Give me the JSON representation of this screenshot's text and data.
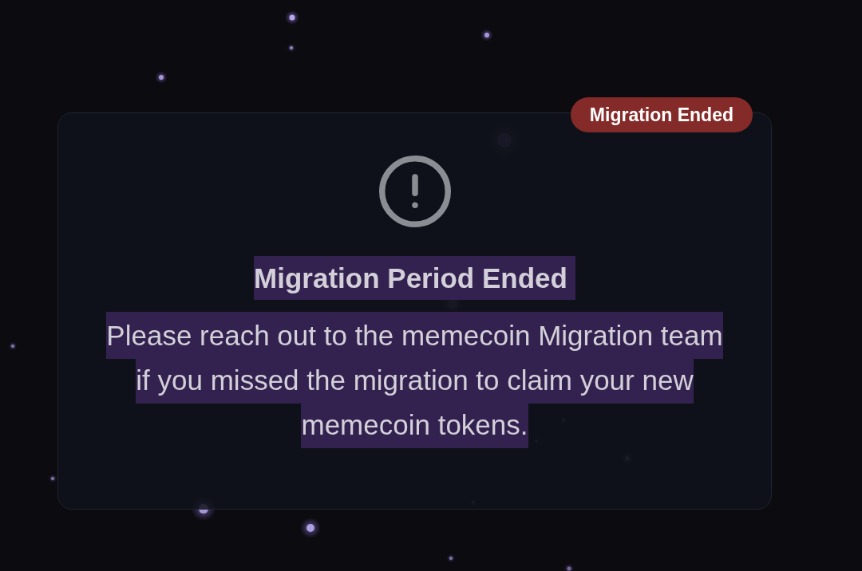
{
  "badge": {
    "label": "Migration Ended"
  },
  "notice": {
    "title": "Migration Period Ended",
    "message": "Please reach out to the memecoin Migration team if you missed the migration to claim your new memecoin tokens.",
    "text_selected": true
  }
}
